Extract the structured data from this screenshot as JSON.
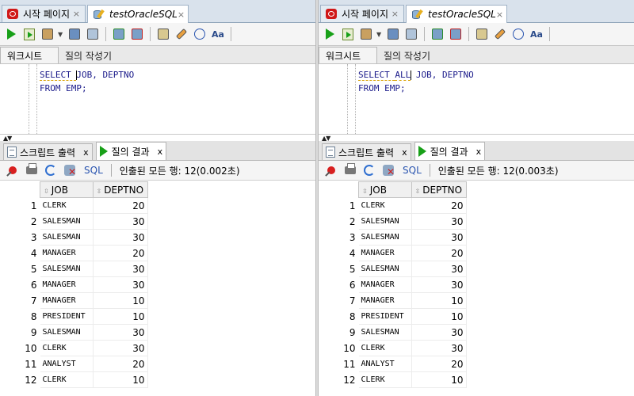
{
  "editor_tabs": {
    "start_page": "시작 페이지",
    "sql_tab": "testOracleSQL",
    "close": "×"
  },
  "subtabs": {
    "worksheet": "워크시트",
    "query_builder": "질의 작성기"
  },
  "result_tabs": {
    "script_output": "스크립트 출력",
    "query_result": "질의 결과",
    "close": "x"
  },
  "toolbar2": {
    "sql_link": "SQL"
  },
  "columns": [
    "JOB",
    "DEPTNO"
  ],
  "left": {
    "code_line1_pre": "SELECT ",
    "code_line1_kw": "",
    "code_line1_post": "JOB, DEPTNO",
    "code_line2": "FROM EMP;",
    "status": "인출된 모든 행: 12(0.002초)",
    "rows": [
      [
        "1",
        "CLERK",
        "20"
      ],
      [
        "2",
        "SALESMAN",
        "30"
      ],
      [
        "3",
        "SALESMAN",
        "30"
      ],
      [
        "4",
        "MANAGER",
        "20"
      ],
      [
        "5",
        "SALESMAN",
        "30"
      ],
      [
        "6",
        "MANAGER",
        "30"
      ],
      [
        "7",
        "MANAGER",
        "10"
      ],
      [
        "8",
        "PRESIDENT",
        "10"
      ],
      [
        "9",
        "SALESMAN",
        "30"
      ],
      [
        "10",
        "CLERK",
        "30"
      ],
      [
        "11",
        "ANALYST",
        "20"
      ],
      [
        "12",
        "CLERK",
        "10"
      ]
    ]
  },
  "right": {
    "code_line1_pre": "SELECT ",
    "code_line1_kw": "ALL",
    "code_line1_post": " JOB, DEPTNO",
    "code_line2": "FROM EMP;",
    "status": "인출된 모든 행: 12(0.003초)",
    "rows": [
      [
        "1",
        "CLERK",
        "20"
      ],
      [
        "2",
        "SALESMAN",
        "30"
      ],
      [
        "3",
        "SALESMAN",
        "30"
      ],
      [
        "4",
        "MANAGER",
        "20"
      ],
      [
        "5",
        "SALESMAN",
        "30"
      ],
      [
        "6",
        "MANAGER",
        "30"
      ],
      [
        "7",
        "MANAGER",
        "10"
      ],
      [
        "8",
        "PRESIDENT",
        "10"
      ],
      [
        "9",
        "SALESMAN",
        "30"
      ],
      [
        "10",
        "CLERK",
        "30"
      ],
      [
        "11",
        "ANALYST",
        "20"
      ],
      [
        "12",
        "CLERK",
        "10"
      ]
    ]
  }
}
